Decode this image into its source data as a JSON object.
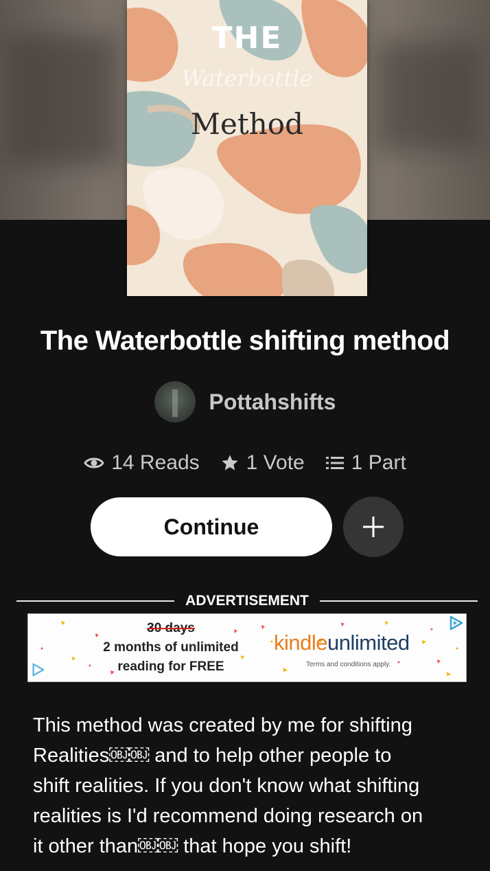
{
  "cover": {
    "line1": "THE",
    "line2": "Waterbottle",
    "line3": "Method",
    "colors": [
      "#e7a47e",
      "#a9c0bd",
      "#f3e7d8",
      "#d8c3ad"
    ]
  },
  "story": {
    "title": "The Waterbottle shifting method",
    "author": "Pottahshifts"
  },
  "stats": {
    "reads": "14 Reads",
    "votes": "1 Vote",
    "parts": "1 Part"
  },
  "actions": {
    "continue_label": "Continue",
    "add_icon": "plus-icon"
  },
  "ad": {
    "header": "ADVERTISEMENT",
    "strike_text": "30 days",
    "line1": "2 months of unlimited",
    "line2": "reading for FREE",
    "brand_kindle": "kindle",
    "brand_unlimited": "unlimited",
    "terms": "Terms and conditions apply."
  },
  "description": {
    "lines": [
      "This method was created by me for shifting",
      "Realities￼￼ and to help other people to",
      "shift realities. If you don't know what shifting",
      "realities is I'd recommend doing research on",
      "it other than￼￼ that hope you shift!"
    ]
  },
  "colors": {
    "background": "#121212",
    "button_primary": "#ffffff",
    "button_secondary": "#353535",
    "muted_text": "#c9c9c9"
  }
}
